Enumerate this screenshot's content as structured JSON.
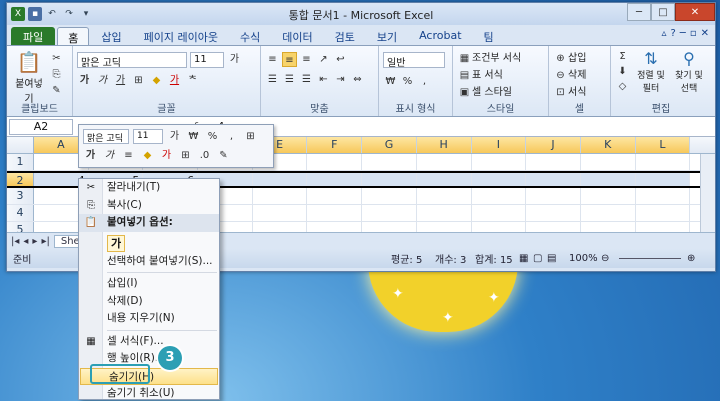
{
  "window": {
    "title": "통합 문서1 - Microsoft Excel",
    "controls": [
      "─",
      "□",
      "✕"
    ]
  },
  "tabs": [
    "파일",
    "홈",
    "삽입",
    "페이지 레이아웃",
    "수식",
    "데이터",
    "검토",
    "보기",
    "Acrobat",
    "팀"
  ],
  "ribbon": {
    "clipboard": {
      "paste": "붙여넣기",
      "label": "클립보드"
    },
    "font": {
      "name": "맑은 고딕",
      "size": "11",
      "label": "글꼴"
    },
    "align": {
      "label": "맞춤"
    },
    "number": {
      "format": "일반",
      "label": "표시 형식"
    },
    "style": {
      "cond": "조건부 서식",
      "table": "표 서식",
      "cell": "셀 스타일",
      "label": "스타일"
    },
    "cells": {
      "insert": "삽입",
      "delete": "삭제",
      "format": "서식",
      "label": "셀"
    },
    "edit": {
      "sort": "정렬 및 필터",
      "find": "찾기 및 선택",
      "label": "편집"
    }
  },
  "formula": {
    "namebox": "A2",
    "fx": "fx",
    "value": "4"
  },
  "columns": [
    "A",
    "B",
    "C",
    "D",
    "E",
    "F",
    "G",
    "H",
    "I",
    "J",
    "K",
    "L"
  ],
  "rows": [
    {
      "num": "1",
      "cells": [
        "",
        "",
        "",
        "",
        "",
        "",
        "",
        "",
        "",
        "",
        "",
        ""
      ]
    },
    {
      "num": "2",
      "cells": [
        "4",
        "5",
        "6",
        "",
        "",
        "",
        "",
        "",
        "",
        "",
        "",
        ""
      ]
    },
    {
      "num": "3",
      "cells": [
        "",
        "",
        "",
        "",
        "",
        "",
        "",
        "",
        "",
        "",
        "",
        ""
      ]
    },
    {
      "num": "4",
      "cells": [
        "",
        "",
        "",
        "",
        "",
        "",
        "",
        "",
        "",
        "",
        "",
        ""
      ]
    },
    {
      "num": "5",
      "cells": [
        "",
        "",
        "",
        "",
        "",
        "",
        "",
        "",
        "",
        "",
        "",
        ""
      ]
    }
  ],
  "sheet_tab": "She",
  "status": {
    "ready": "준비",
    "avg": "평균: 5",
    "count": "개수: 3",
    "sum": "합계: 15",
    "zoom": "100%"
  },
  "minitoolbar": {
    "font": "맑은 고딕",
    "size": "11"
  },
  "context_menu": {
    "cut": "잘라내기(T)",
    "copy": "복사(C)",
    "paste_options": "붙여넣기 옵션:",
    "paste_icon": "가",
    "paste_special": "선택하여 붙여넣기(S)...",
    "insert": "삽입(I)",
    "delete": "삭제(D)",
    "clear": "내용 지우기(N)",
    "format_cells": "셀 서식(F)...",
    "row_height": "행 높이(R)...",
    "hide": "숨기기(H)",
    "unhide": "숨기기 취소(U)"
  },
  "step_badge": "3"
}
